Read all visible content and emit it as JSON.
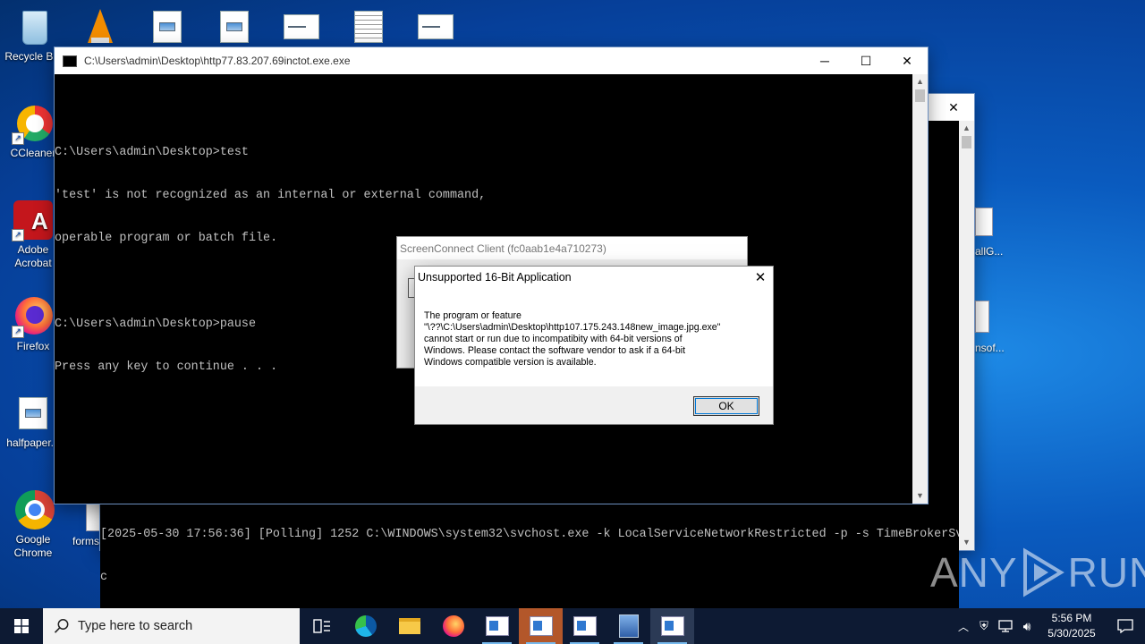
{
  "desktop": {
    "left_icons": [
      {
        "label": "Recycle Bin",
        "icon": "recycle-bin-icon"
      },
      {
        "label": "CCleaner",
        "icon": "ccleaner-icon"
      },
      {
        "label": "Adobe Acrobat",
        "icon": "adobe-acrobat-icon"
      },
      {
        "label": "Firefox",
        "icon": "firefox-icon"
      },
      {
        "label": "halfpaper...",
        "icon": "image-file-icon"
      },
      {
        "label": "Google Chrome",
        "icon": "chrome-icon"
      }
    ],
    "peek_labels": {
      "forms": "forms",
      "allg": "allG...",
      "nsof": "nsof..."
    }
  },
  "console_main": {
    "title": "C:\\Users\\admin\\Desktop\\http77.83.207.69inctot.exe.exe",
    "lines": [
      "",
      "C:\\Users\\admin\\Desktop>test",
      "'test' is not recognized as an internal or external command,",
      "operable program or batch file.",
      "",
      "C:\\Users\\admin\\Desktop>pause",
      "Press any key to continue . . ."
    ]
  },
  "console_back": {
    "lines": [
      "[2025-05-30 17:56:36] [Polling] 1252 C:\\WINDOWS\\system32\\svchost.exe -k LocalServiceNetworkRestricted -p -s TimeBrokerSv",
      "c"
    ]
  },
  "screenconnect": {
    "title": "ScreenConnect Client (fc0aab1e4a710273)"
  },
  "dialog": {
    "title": "Unsupported 16-Bit Application",
    "message_lines": [
      "The program or feature",
      "\"\\??\\C:\\Users\\admin\\Desktop\\http107.175.243.148new_image.jpg.exe\"",
      "cannot start or run due to incompatibity with 64-bit versions of",
      "Windows. Please contact the software vendor to ask if a 64-bit",
      "Windows compatible version is available."
    ],
    "ok_label": "OK"
  },
  "taskbar": {
    "search_placeholder": "Type here to search",
    "time": "5:56 PM",
    "date": "5/30/2025"
  },
  "watermark": {
    "text_left": "ANY",
    "text_right": "RUN"
  },
  "colors": {
    "accent": "#0078d7",
    "taskbar": "#0d1a33",
    "highlight_task": "#b3572a"
  }
}
